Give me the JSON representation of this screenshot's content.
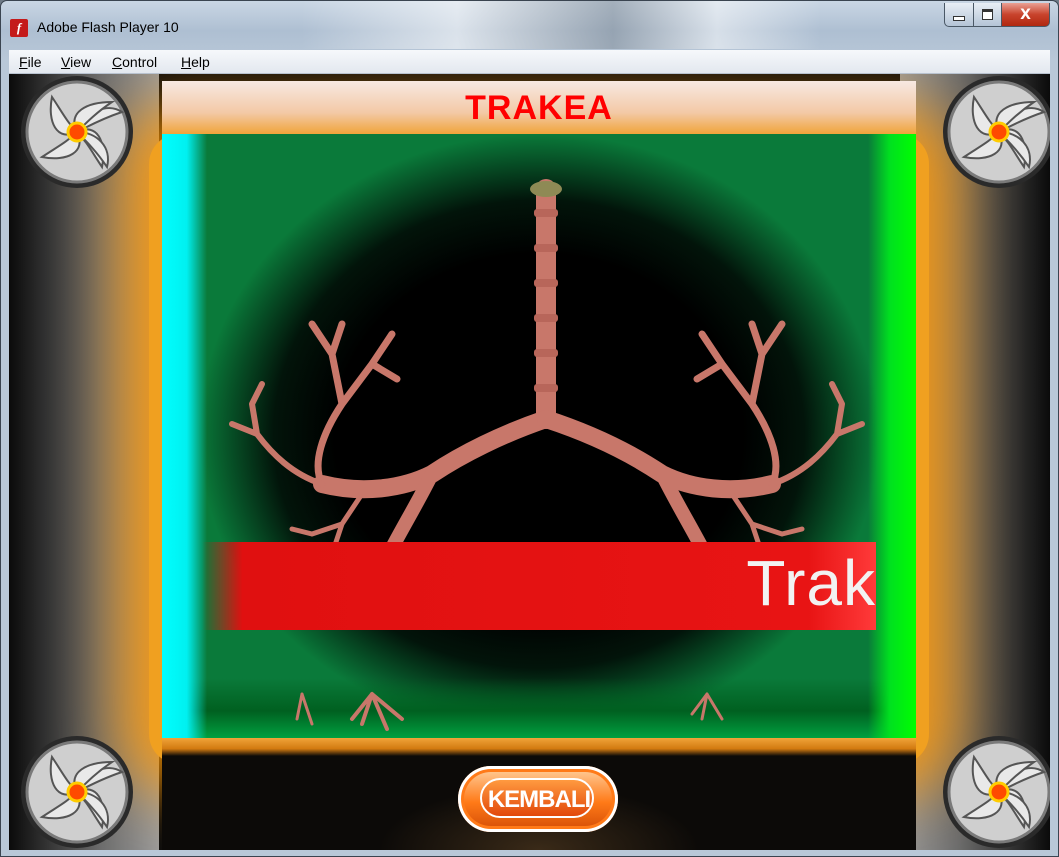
{
  "window": {
    "title": "Adobe Flash Player 10",
    "icon": "flash-player-icon",
    "close_symbol": "X"
  },
  "menubar": {
    "items": [
      "File",
      "View",
      "Control",
      "Help"
    ]
  },
  "stage": {
    "title": "TRAKEA",
    "caption": "Trak",
    "back_button": "KEMBALI",
    "decorations": [
      "fan-icon",
      "fan-icon",
      "fan-icon",
      "fan-icon"
    ],
    "colors": {
      "title": "#ff0000",
      "caption_band": "#e81414",
      "left_edge": "#00ffff",
      "right_edge": "#00ff00",
      "glow": "#f0a020",
      "button": "#ff7a18"
    }
  }
}
